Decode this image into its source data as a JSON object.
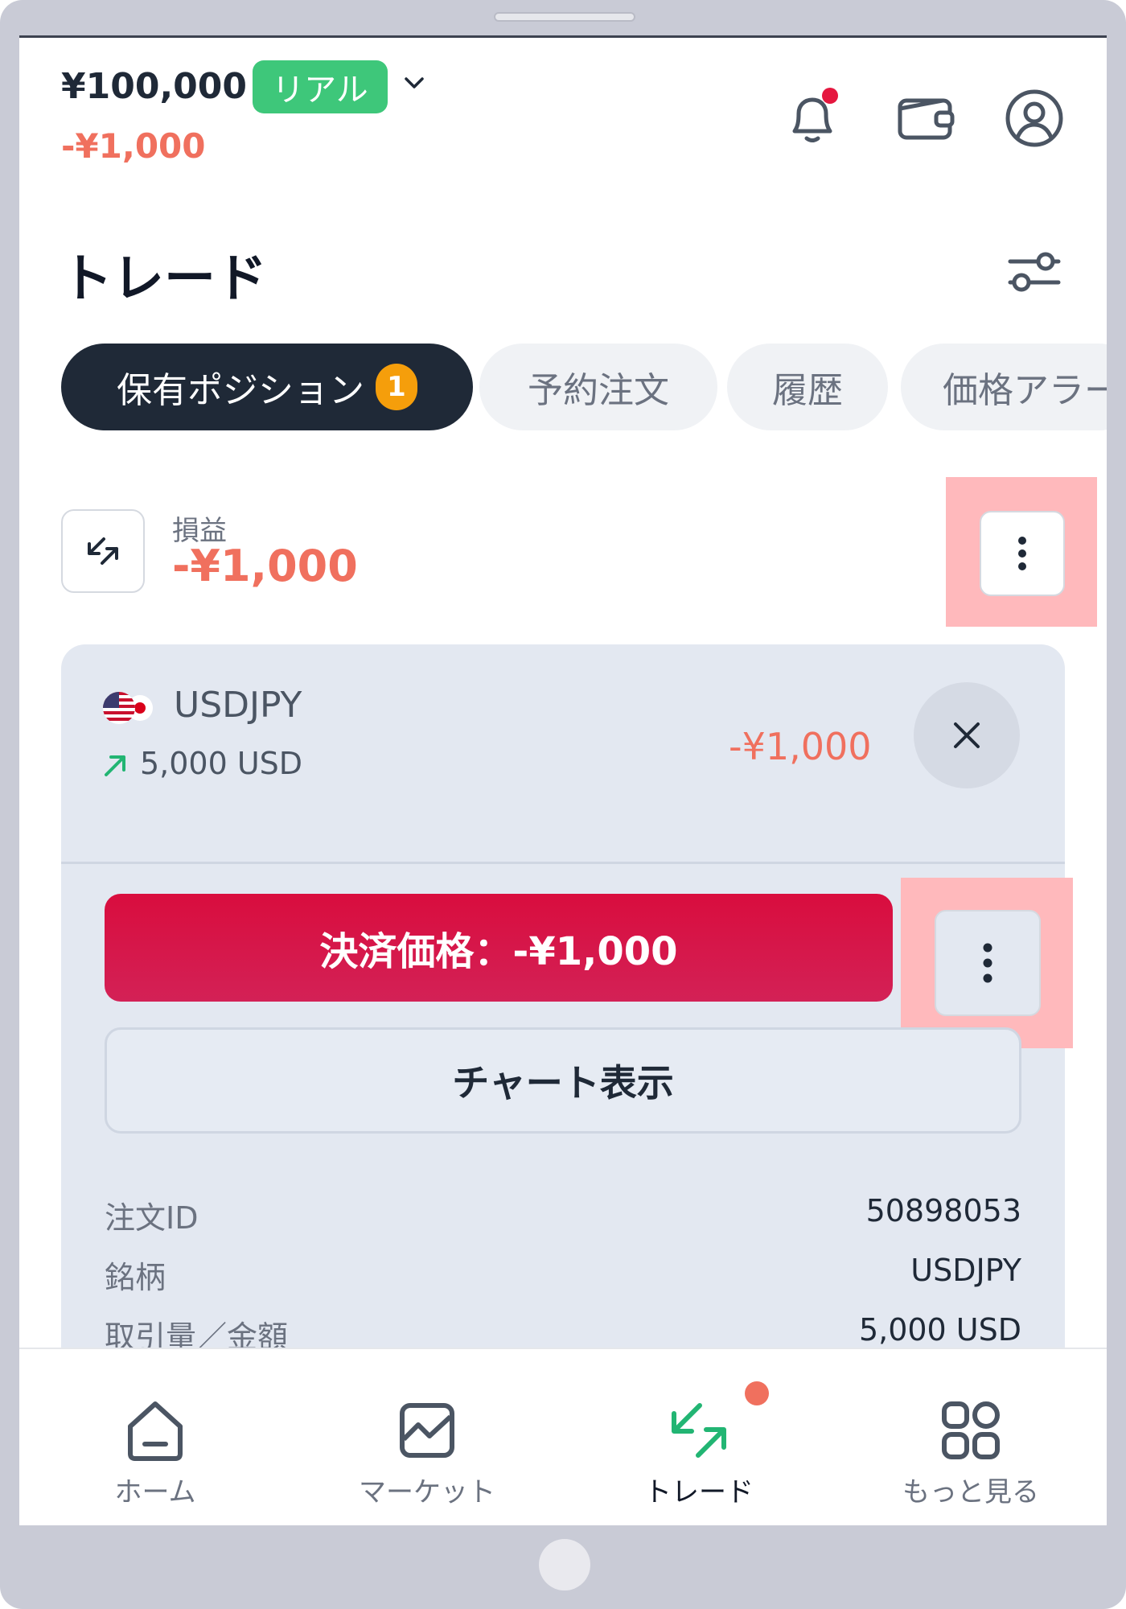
{
  "header": {
    "balance": "¥100,000",
    "account_type": "リアル",
    "pnl": "-¥1,000",
    "icons": [
      "bell-icon",
      "wallet-icon",
      "profile-icon"
    ]
  },
  "page": {
    "title": "トレード"
  },
  "tabs": [
    {
      "label": "保有ポジション",
      "count": "1",
      "active": true
    },
    {
      "label": "予約注文"
    },
    {
      "label": "履歴"
    },
    {
      "label": "価格アラート"
    }
  ],
  "pnl_summary": {
    "label": "損益",
    "value": "-¥1,000"
  },
  "position": {
    "symbol": "USDJPY",
    "volume": "5,000 USD",
    "pnl": "-¥1,000",
    "settle_button": "決済価格：-¥1,000",
    "chart_button": "チャート表示",
    "details": [
      {
        "label": "注文ID",
        "value": "50898053"
      },
      {
        "label": "銘柄",
        "value": "USDJPY"
      },
      {
        "label": "取引量／金額",
        "value": "5,000 USD"
      }
    ]
  },
  "bottom_nav": [
    {
      "label": "ホーム",
      "icon": "home-icon"
    },
    {
      "label": "マーケット",
      "icon": "market-icon"
    },
    {
      "label": "トレード",
      "icon": "trade-icon",
      "active": true
    },
    {
      "label": "もっと見る",
      "icon": "more-icon"
    }
  ],
  "colors": {
    "accent_green": "#3ec77a",
    "loss_red": "#f0705e",
    "settle_red": "#d90d3e",
    "dark": "#1f2937",
    "highlight": "#ffb9bc"
  }
}
